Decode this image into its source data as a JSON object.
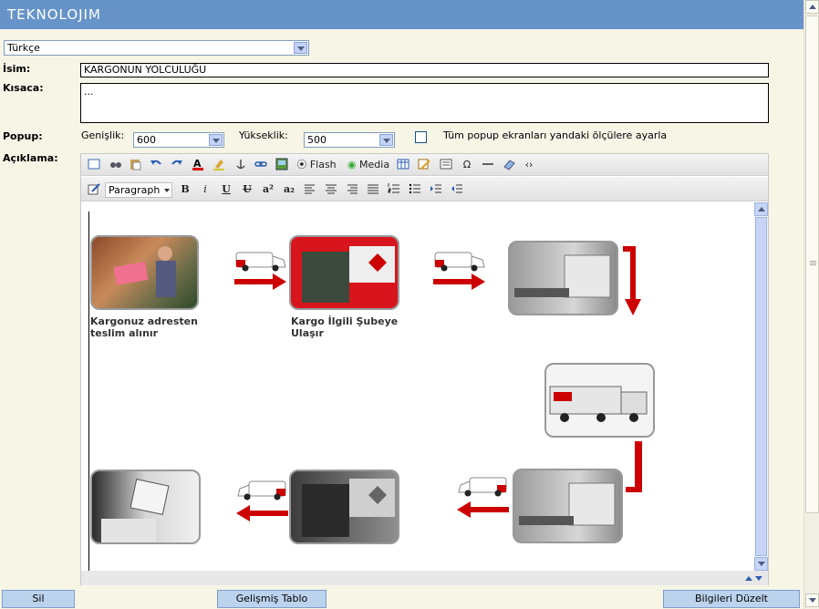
{
  "header": {
    "logo": "TEKNOLOJIM"
  },
  "language": {
    "selected": "Türkçe"
  },
  "form": {
    "name_label": "İsim:",
    "name_value": "KARGONUN YOLCULUĞU",
    "summary_label": "Kısaca:",
    "summary_value": "...",
    "popup_label": "Popup:",
    "width_label": "Genişlik:",
    "width_value": "600",
    "height_label": "Yükseklik:",
    "height_value": "500",
    "popup_all_label": "Tüm popup ekranları yandaki ölçülere ayarla",
    "desc_label": "Açıklama:"
  },
  "editor": {
    "toolbar1": {
      "flash_label": "Flash",
      "media_label": "Media"
    },
    "toolbar2": {
      "format_select": "Paragraph"
    },
    "captions": {
      "step1": "Kargonuz adresten teslim alınır",
      "step2": "Kargo İlgili Şubeye Ulaşır"
    }
  },
  "buttons": {
    "delete": "Sil",
    "advanced_table": "Gelişmiş Tablo",
    "edit_info": "Bilgileri Düzelt"
  },
  "colors": {
    "header": "#6694c8",
    "page_bg": "#f6f5e6",
    "arrow_red": "#cc0000"
  }
}
